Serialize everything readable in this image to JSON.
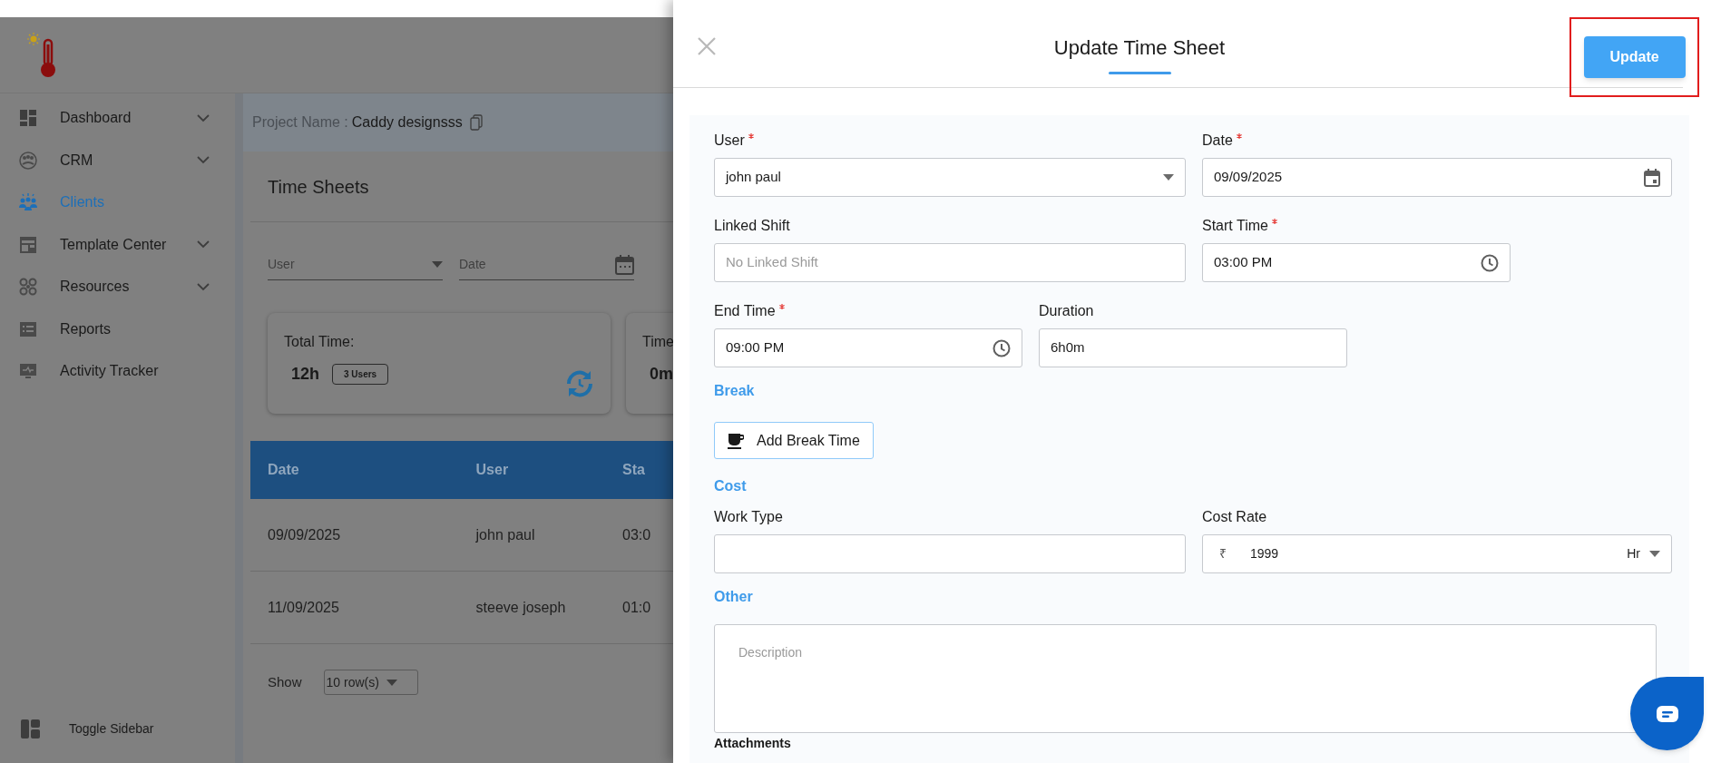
{
  "sidebar": {
    "items": [
      {
        "label": "Dashboard",
        "expandable": true,
        "selected": false
      },
      {
        "label": "CRM",
        "expandable": true,
        "selected": false
      },
      {
        "label": "Clients",
        "expandable": false,
        "selected": true
      },
      {
        "label": "Template Center",
        "expandable": true,
        "selected": false
      },
      {
        "label": "Resources",
        "expandable": true,
        "selected": false
      },
      {
        "label": "Reports",
        "expandable": false,
        "selected": false
      },
      {
        "label": "Activity Tracker",
        "expandable": false,
        "selected": false
      }
    ],
    "toggle": "Toggle Sidebar"
  },
  "project": {
    "label": "Project Name :",
    "name": "Caddy designsss"
  },
  "time_sheets": {
    "title": "Time Sheets",
    "filters": [
      {
        "label": "User",
        "kind": "select"
      },
      {
        "label": "Date",
        "kind": "date"
      }
    ],
    "stats": [
      {
        "label": "Total Time:",
        "value": "12h",
        "badge": "3 Users"
      },
      {
        "label": "Time",
        "value": "0m"
      }
    ],
    "table": {
      "columns": [
        "Date",
        "User",
        "Sta"
      ],
      "rows": [
        [
          "09/09/2025",
          "john paul",
          "03:0"
        ],
        [
          "11/09/2025",
          "steeve joseph",
          "01:0"
        ]
      ]
    },
    "show_label": "Show",
    "rows_per_page": "10 row(s)"
  },
  "panel": {
    "title": "Update Time Sheet",
    "update_button": "Update",
    "blocks": [
      {
        "kind": "fields",
        "fields": [
          {
            "label": "User",
            "required": true,
            "kind": "select",
            "value": "john paul"
          },
          {
            "label": "Date",
            "required": true,
            "kind": "date",
            "value": "09/09/2025"
          }
        ]
      },
      {
        "kind": "fields",
        "fields": [
          {
            "label": "Linked Shift",
            "required": false,
            "kind": "text",
            "placeholder": "No Linked Shift"
          },
          {
            "label": "Start Time",
            "required": true,
            "kind": "time",
            "value": "03:00 PM"
          }
        ]
      },
      {
        "kind": "fields",
        "fields": [
          {
            "label": "End Time",
            "required": true,
            "kind": "time",
            "value": "09:00 PM"
          },
          {
            "label": "Duration",
            "required": false,
            "kind": "text",
            "value": "6h0m"
          }
        ]
      },
      {
        "kind": "heading",
        "text": "Break"
      },
      {
        "kind": "button",
        "label": "Add Break Time"
      },
      {
        "kind": "heading",
        "text": "Cost"
      },
      {
        "kind": "fields",
        "fields": [
          {
            "label": "Work Type",
            "required": false,
            "kind": "text"
          },
          {
            "label": "Cost Rate",
            "required": false,
            "kind": "money",
            "currency": "₹",
            "value": "1999",
            "unit": "Hr"
          }
        ]
      },
      {
        "kind": "heading",
        "text": "Other"
      },
      {
        "kind": "textarea",
        "placeholder": "Description"
      },
      {
        "kind": "label",
        "text": "Attachments"
      }
    ]
  }
}
